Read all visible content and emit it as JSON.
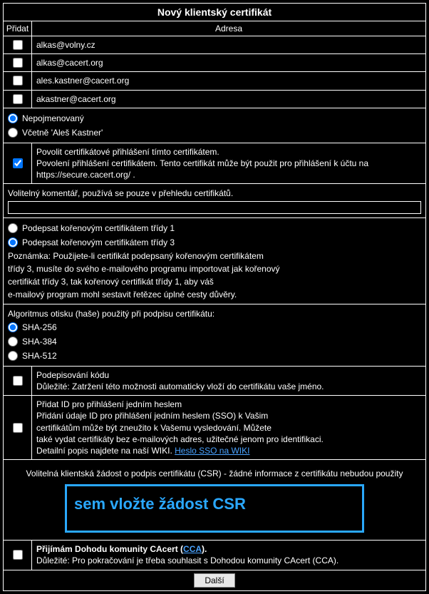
{
  "title": "Nový klientský certifikát",
  "header": {
    "add": "Přidat",
    "address": "Adresa"
  },
  "emails": [
    "alkas@volny.cz",
    "alkas@cacert.org",
    "ales.kastner@cacert.org",
    "akastner@cacert.org"
  ],
  "name_section": {
    "unnamed": "Nepojmenovaný",
    "include": "Včetně 'Aleš Kastner'"
  },
  "cert_login": {
    "line1": "Povolit certifikátové přihlášení tímto certifikátem.",
    "line2": "Povolení přihlášení certifikátem. Tento certifikát může být použit pro přihlášení k účtu na https://secure.cacert.org/ ."
  },
  "comment": {
    "label": "Volitelný komentář, používá se pouze v přehledu certifikátů."
  },
  "sign": {
    "class1": "Podepsat kořenovým certifikátem třídy 1",
    "class3": "Podepsat kořenovým certifikátem třídy 3",
    "note1": "Poznámka: Použijete-li certifikát podepsaný kořenovým certifikátem",
    "note2": "třídy 3, musíte do svého e-mailového programu importovat jak kořenový",
    "note3": "certifikát třídy 3, tak kořenový certifikát třídy 1, aby váš",
    "note4": "e-mailový program mohl sestavit řetězec úplné cesty důvěry."
  },
  "hash": {
    "label": "Algoritmus otisku (haše) použitý při podpisu certifikátu:",
    "sha256": "SHA-256",
    "sha384": "SHA-384",
    "sha512": "SHA-512"
  },
  "code_sign": {
    "line1": "Podepisování kódu",
    "line2": "Důležité: Zatržení této možnosti automaticky vloží do certifikátu vaše jméno."
  },
  "sso": {
    "line1": "Přidat ID pro přihlášení jedním heslem",
    "line2": "Přidání údaje ID pro přihlášení jedním heslem (SSO) k Vašim",
    "line3": "certifikátům může být zneužito k Vašemu vysledování. Můžete",
    "line4": "také vydat certifikáty bez e-mailových adres, užitečné jenom pro identifikaci.",
    "line5": "Detailní popis najdete na naší WIKI. ",
    "link": "Heslo SSO na WIKI"
  },
  "csr": {
    "label": "Volitelná klientská žádost o podpis certifikátu (CSR) - žádné informace z certifikátu nebudou použity",
    "placeholder": "sem vložte žádost CSR"
  },
  "cca": {
    "line1a": "Přijímám Dohodu komunity CAcert (",
    "line1link": "CCA",
    "line1b": ").",
    "line2": "Důležité: Pro pokračování je třeba souhlasit s Dohodou komunity CAcert (CCA)."
  },
  "submit": "Další"
}
